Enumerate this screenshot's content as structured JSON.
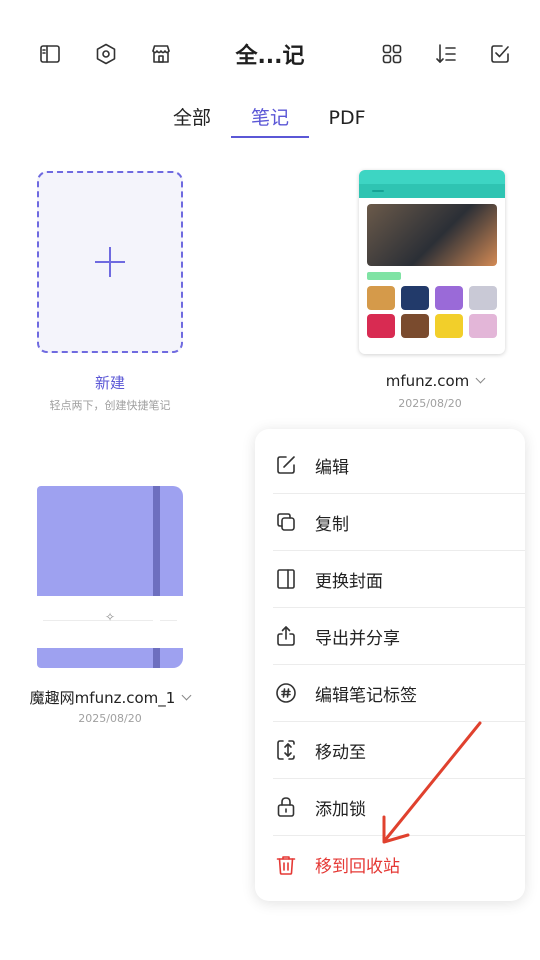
{
  "header": {
    "title": "全...记",
    "left_icons": [
      "sidebar-icon",
      "settings-hex-icon",
      "store-icon"
    ],
    "right_icons": [
      "grid-view-icon",
      "sort-icon",
      "multi-select-icon"
    ]
  },
  "tabs": [
    {
      "label": "全部",
      "active": false
    },
    {
      "label": "笔记",
      "active": true
    },
    {
      "label": "PDF",
      "active": false
    }
  ],
  "colors": {
    "accent": "#5b57d6",
    "danger": "#e53935",
    "notebook_cover": "#9ea1f0"
  },
  "new_note": {
    "label": "新建",
    "hint": "轻点两下，创建快捷笔记"
  },
  "notes": [
    {
      "name": "mfunz.com",
      "date": "2025/08/20"
    },
    {
      "name": "魔趣网mfunz.com_1",
      "date": "2025/08/20"
    }
  ],
  "context_menu": {
    "items": [
      {
        "label": "编辑",
        "icon": "edit-icon"
      },
      {
        "label": "复制",
        "icon": "copy-icon"
      },
      {
        "label": "更换封面",
        "icon": "cover-icon"
      },
      {
        "label": "导出并分享",
        "icon": "share-icon"
      },
      {
        "label": "编辑笔记标签",
        "icon": "tag-icon"
      },
      {
        "label": "移动至",
        "icon": "move-icon"
      },
      {
        "label": "添加锁",
        "icon": "lock-icon"
      },
      {
        "label": "移到回收站",
        "icon": "trash-icon"
      }
    ]
  }
}
